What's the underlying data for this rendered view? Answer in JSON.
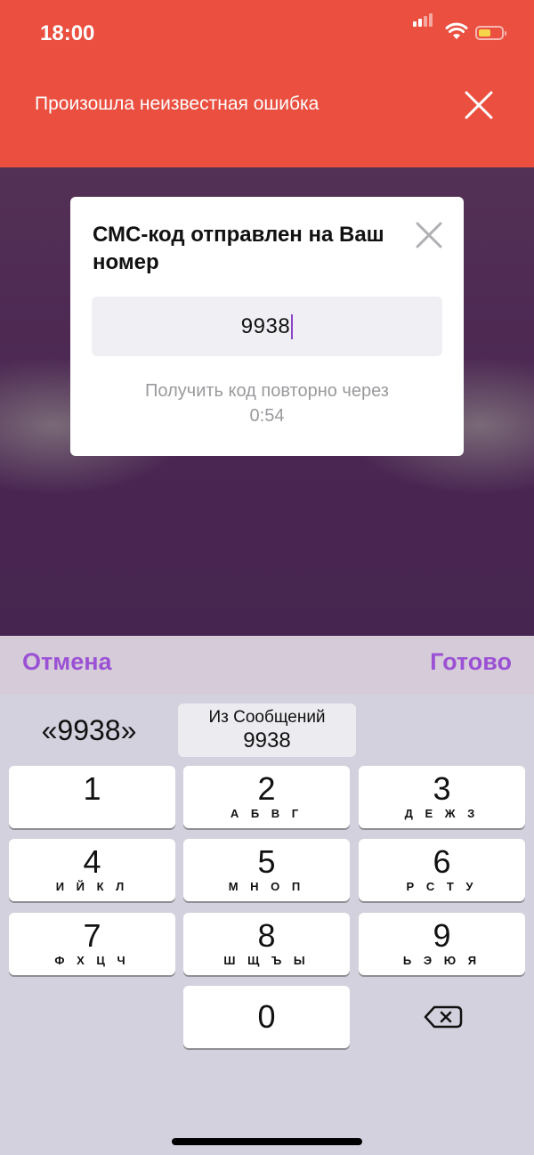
{
  "status_bar": {
    "time": "18:00"
  },
  "banner": {
    "message": "Произошла неизвестная ошибка"
  },
  "modal": {
    "title": "СМС-код отправлен на Ваш номер",
    "code_value": "9938",
    "resend_text": "Получить код повторно через",
    "resend_timer": "0:54"
  },
  "keyboard_toolbar": {
    "cancel_label": "Отмена",
    "done_label": "Готово"
  },
  "suggestions": {
    "quoted_code": "«9938»",
    "source_label": "Из Сообщений",
    "source_code": "9938"
  },
  "keypad": {
    "keys": [
      {
        "digit": "1",
        "letters": ""
      },
      {
        "digit": "2",
        "letters": "А Б В Г"
      },
      {
        "digit": "3",
        "letters": "Д Е Ж З"
      },
      {
        "digit": "4",
        "letters": "И Й К Л"
      },
      {
        "digit": "5",
        "letters": "М Н О П"
      },
      {
        "digit": "6",
        "letters": "Р С Т У"
      },
      {
        "digit": "7",
        "letters": "Ф Х Ц Ч"
      },
      {
        "digit": "8",
        "letters": "Ш Щ Ъ Ы"
      },
      {
        "digit": "9",
        "letters": "Ь Э Ю Я"
      },
      {
        "digit": "0",
        "letters": ""
      }
    ]
  },
  "colors": {
    "banner": "#ea4f40",
    "accent": "#9b51d4",
    "battery": "#f5d64b"
  },
  "icons": {
    "banner_close": "close-icon",
    "modal_close": "close-icon",
    "backspace": "backspace-icon",
    "wifi": "wifi-icon",
    "signal": "cellular-signal-icon",
    "battery": "battery-icon"
  }
}
